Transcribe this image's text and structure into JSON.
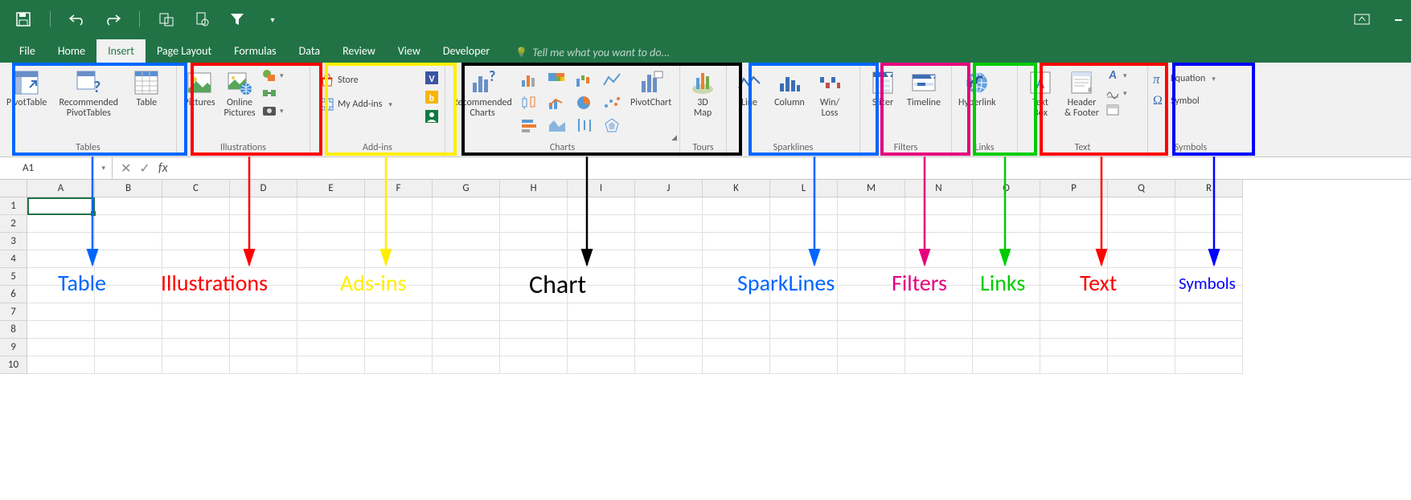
{
  "tabs": {
    "file": "File",
    "home": "Home",
    "insert": "Insert",
    "pagelayout": "Page Layout",
    "formulas": "Formulas",
    "data": "Data",
    "review": "Review",
    "view": "View",
    "developer": "Developer",
    "tellme": "Tell me what you want to do..."
  },
  "groups": {
    "tables": {
      "label": "Tables",
      "pivottable": "PivotTable",
      "recpivot": "Recommended\nPivotTables",
      "table": "Table"
    },
    "illus": {
      "label": "Illustrations",
      "pictures": "Pictures",
      "online": "Online\nPictures"
    },
    "addins": {
      "label": "Add-ins",
      "store": "Store",
      "myaddins": "My Add-ins"
    },
    "charts": {
      "label": "Charts",
      "reccharts": "Recommended\nCharts",
      "pivotchart": "PivotChart"
    },
    "tours": {
      "label": "Tours",
      "map": "3D\nMap"
    },
    "spark": {
      "label": "Sparklines",
      "line": "Line",
      "column": "Column",
      "winloss": "Win/\nLoss"
    },
    "filters": {
      "label": "Filters",
      "slicer": "Slicer",
      "timeline": "Timeline"
    },
    "links": {
      "label": "Links",
      "hyperlink": "Hyperlink"
    },
    "text": {
      "label": "Text",
      "textbox": "Text\nBox",
      "header": "Header\n& Footer"
    },
    "symbols": {
      "label": "Symbols",
      "equation": "Equation",
      "symbol": "Symbol"
    }
  },
  "formulaBar": {
    "cellref": "A1"
  },
  "columns": [
    "A",
    "B",
    "C",
    "D",
    "E",
    "F",
    "G",
    "H",
    "I",
    "J",
    "K",
    "L",
    "M",
    "N",
    "O",
    "P",
    "Q",
    "R"
  ],
  "rows": [
    "1",
    "2",
    "3",
    "4",
    "5",
    "6",
    "7",
    "8",
    "9",
    "10"
  ],
  "annotations": {
    "table": "Table",
    "illustrations": "Illustrations",
    "addins": "Ads-ins",
    "chart": "Chart",
    "sparklines": "SparkLines",
    "filters": "Filters",
    "links": "Links",
    "text": "Text",
    "symbols": "Symbols"
  }
}
